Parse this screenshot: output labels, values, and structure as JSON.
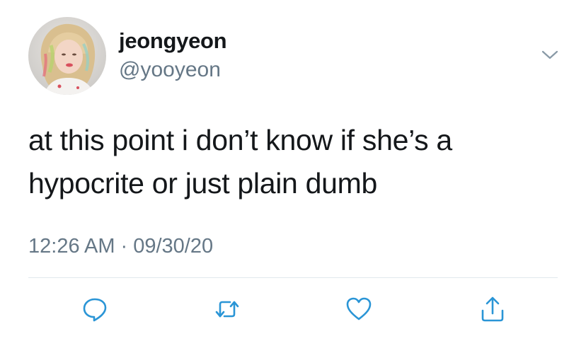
{
  "user": {
    "display_name": "jeongyeon",
    "handle": "@yooyeon",
    "avatar_icon": "profile-photo"
  },
  "tweet": {
    "lines": [
      "at this point i don’t know if she’s a",
      "hypocrite or just plain dumb"
    ],
    "time": "12:26 AM",
    "separator": "·",
    "date": "09/30/20"
  },
  "actions": {
    "reply_icon": "reply-icon",
    "retweet_icon": "retweet-icon",
    "like_icon": "heart-icon",
    "share_icon": "share-icon"
  },
  "colors": {
    "text": "#14171a",
    "secondary": "#657786",
    "icon": "#2a95d6",
    "divider": "#e1e8ed"
  }
}
